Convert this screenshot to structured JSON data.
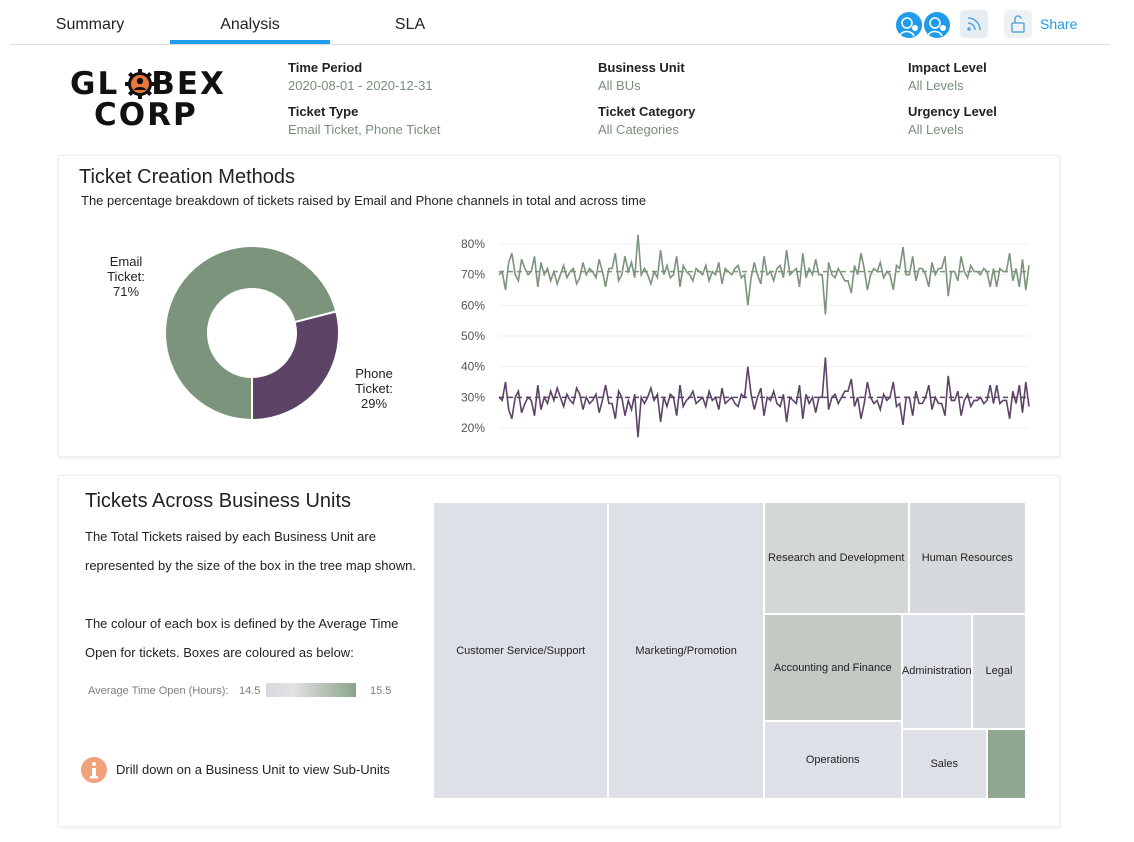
{
  "nav": {
    "tabs": [
      {
        "label": "Summary",
        "active": false
      },
      {
        "label": "Analysis",
        "active": true
      },
      {
        "label": "SLA",
        "active": false
      }
    ],
    "share_label": "Share",
    "icons": [
      "user-avatar-icon",
      "user-avatar-icon",
      "rss-icon",
      "unlock-icon"
    ],
    "accent_color": "#1e9be9"
  },
  "logo": {
    "line1": "GL",
    "line1b": "BEX",
    "line2": "CORP"
  },
  "filters": [
    {
      "label": "Time Period",
      "value": "2020-08-01 - 2020-12-31"
    },
    {
      "label": "Business Unit",
      "value": "All BUs"
    },
    {
      "label": "Impact Level",
      "value": "All Levels"
    },
    {
      "label": "Ticket Type",
      "value": "Email Ticket, Phone Ticket"
    },
    {
      "label": "Ticket Category",
      "value": "All Categories"
    },
    {
      "label": "Urgency Level",
      "value": "All Levels"
    }
  ],
  "creation": {
    "title": "Ticket Creation Methods",
    "subtitle": "The percentage breakdown of tickets raised by Email and Phone channels in total and across time",
    "email_label": [
      "Email",
      "Ticket:",
      "71%"
    ],
    "phone_label": [
      "Phone",
      "Ticket:",
      "29%"
    ]
  },
  "bu": {
    "title": "Tickets Across Business Units",
    "desc1": "The Total Tickets raised by each Business Unit are represented by the size of the box in the tree map shown.",
    "desc2": "The colour of each box is defined by the Average Time Open for tickets. Boxes are coloured as below:",
    "legend_label": "Average Time Open (Hours):",
    "legend_min": "14.5",
    "legend_max": "15.5",
    "info_text": "Drill down on a Business Unit to view  Sub-Units"
  },
  "chart_data": [
    {
      "type": "pie",
      "variant": "donut",
      "categories": [
        "Email Ticket",
        "Phone Ticket"
      ],
      "values": [
        71,
        29
      ],
      "colors": [
        "#7b947b",
        "#5d4466"
      ]
    },
    {
      "type": "line",
      "y_ticks": [
        "80%",
        "70%",
        "60%",
        "50%",
        "40%",
        "30%",
        "20%"
      ],
      "ylim": [
        20,
        80
      ],
      "grid": true,
      "series": [
        {
          "color": "#7b947b",
          "mean": 71,
          "values": [
            70,
            71,
            65,
            74,
            77,
            70,
            68,
            75,
            72,
            70,
            71,
            76,
            66,
            74,
            70,
            72,
            68,
            71,
            67,
            70,
            73,
            69,
            71,
            72,
            67,
            69,
            74,
            70,
            72,
            71,
            69,
            75,
            71,
            66,
            72,
            72,
            77,
            68,
            70,
            76,
            71,
            74,
            69,
            83,
            70,
            72,
            70,
            67,
            71,
            69,
            78,
            70,
            73,
            69,
            70,
            76,
            66,
            73,
            71,
            70,
            68,
            72,
            71,
            70,
            73,
            68,
            71,
            70,
            74,
            67,
            72,
            71,
            70,
            72,
            73,
            69,
            70,
            60,
            69,
            74,
            70,
            67,
            76,
            70,
            71,
            68,
            72,
            73,
            69,
            78,
            70,
            71,
            72,
            66,
            77,
            69,
            72,
            70,
            75,
            70,
            70,
            57,
            74,
            70,
            69,
            72,
            70,
            68,
            68,
            64,
            73,
            70,
            77,
            72,
            65,
            70,
            72,
            71,
            74,
            69,
            71,
            70,
            65,
            73,
            72,
            79,
            70,
            70,
            76,
            68,
            72,
            72,
            70,
            66,
            74,
            70,
            72,
            72,
            76,
            63,
            71,
            71,
            68,
            76,
            71,
            69,
            73,
            71,
            71,
            70,
            72,
            71,
            66,
            72,
            66,
            72,
            71,
            71,
            77,
            68,
            72,
            66,
            75,
            65,
            73
          ]
        },
        {
          "color": "#5d4466",
          "mean": 30,
          "values": [
            30,
            29,
            35,
            26,
            23,
            30,
            32,
            25,
            28,
            30,
            29,
            24,
            34,
            26,
            30,
            28,
            32,
            29,
            33,
            30,
            27,
            31,
            29,
            28,
            33,
            31,
            26,
            30,
            28,
            29,
            31,
            25,
            29,
            34,
            28,
            28,
            23,
            32,
            30,
            24,
            29,
            26,
            31,
            17,
            30,
            28,
            30,
            33,
            29,
            31,
            22,
            30,
            27,
            31,
            30,
            24,
            34,
            27,
            29,
            30,
            32,
            28,
            29,
            30,
            27,
            32,
            29,
            30,
            26,
            33,
            28,
            29,
            30,
            28,
            27,
            31,
            30,
            40,
            31,
            26,
            30,
            33,
            24,
            30,
            29,
            32,
            28,
            27,
            31,
            22,
            30,
            29,
            28,
            34,
            23,
            31,
            28,
            30,
            25,
            30,
            30,
            43,
            26,
            30,
            31,
            28,
            30,
            32,
            32,
            36,
            27,
            30,
            23,
            28,
            35,
            30,
            28,
            29,
            26,
            31,
            29,
            30,
            35,
            27,
            28,
            21,
            30,
            30,
            24,
            32,
            28,
            28,
            30,
            34,
            26,
            30,
            28,
            28,
            24,
            37,
            29,
            29,
            32,
            24,
            29,
            31,
            27,
            29,
            29,
            30,
            28,
            29,
            34,
            28,
            34,
            28,
            29,
            29,
            23,
            32,
            28,
            34,
            25,
            35,
            27
          ]
        }
      ]
    },
    {
      "type": "treemap",
      "legend": {
        "label": "Average Time Open (Hours):",
        "min": 14.5,
        "max": 15.5
      },
      "items": [
        {
          "name": "Customer Service/Support",
          "value": 53000,
          "color": "#dde0e6"
        },
        {
          "name": "Marketing/Promotion",
          "value": 47000,
          "color": "#dde0e6"
        },
        {
          "name": "Research and Development",
          "value": 16500,
          "color": "#d3d7d6"
        },
        {
          "name": "Human Resources",
          "value": 13400,
          "color": "#d6d9db"
        },
        {
          "name": "Accounting and Finance",
          "value": 15000,
          "color": "#c3cac4"
        },
        {
          "name": "Administration",
          "value": 8200,
          "color": "#dde0e6"
        },
        {
          "name": "Legal",
          "value": 6300,
          "color": "#d8dbdf"
        },
        {
          "name": "Operations",
          "value": 10900,
          "color": "#dde0e6"
        },
        {
          "name": "Sales",
          "value": 6100,
          "color": "#dde0e6"
        },
        {
          "name": "",
          "value": 2800,
          "color": "#91a691"
        }
      ]
    }
  ]
}
